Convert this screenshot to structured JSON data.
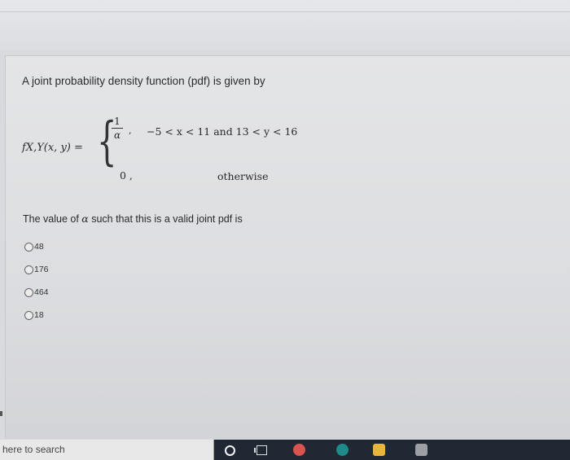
{
  "question": {
    "intro": "A joint probability density function (pdf) is given by",
    "formula": {
      "lhs": "fX,Y(x, y) =",
      "case1_numerator": "1",
      "case1_denominator": "α",
      "case1_comma": ",",
      "case1_condition": "−5 < x < 11  and  13 < y < 16",
      "case2_value": "0 ,",
      "case2_condition": "otherwise"
    },
    "prompt_pre": "The value of ",
    "prompt_alpha": "α",
    "prompt_post": " such that this is a valid joint pdf is",
    "options": [
      "48",
      "176",
      "464",
      "18"
    ]
  },
  "taskbar": {
    "search_placeholder": "here to search",
    "icons": [
      "cortana-icon",
      "task-view-icon",
      "chrome-icon",
      "edge-icon",
      "file-explorer-icon",
      "store-icon"
    ]
  },
  "colors": {
    "background": "#d9dadd",
    "text": "#2a2a2a",
    "taskbar": "#1f2833",
    "chrome": "#d9534f",
    "edge": "#1e8a8a",
    "explorer": "#e8b43c",
    "store": "#9ca0a5"
  }
}
